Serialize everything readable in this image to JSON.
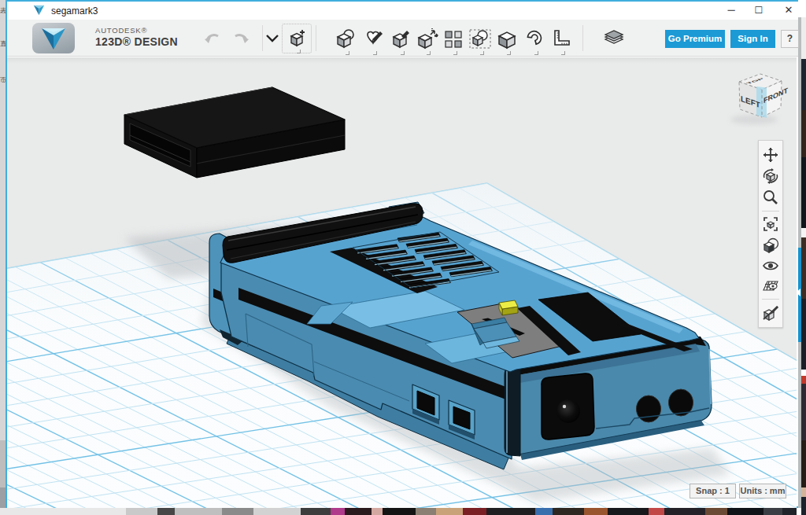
{
  "window": {
    "title": "segamark3",
    "controls": {
      "minimize": "─",
      "maximize": "☐",
      "close": "✕"
    },
    "border_color": "#41aede"
  },
  "background": {
    "left_glyphs": [
      "表",
      "真",
      "页"
    ]
  },
  "brand": {
    "company": "AUTODESK®",
    "product": "123D® DESIGN",
    "caret": "⌄"
  },
  "toolbar": {
    "tools": [
      {
        "name": "undo"
      },
      {
        "name": "redo"
      },
      {
        "name": "primitives"
      },
      {
        "name": "transform"
      },
      {
        "name": "sketch"
      },
      {
        "name": "construct"
      },
      {
        "name": "modify"
      },
      {
        "name": "pattern"
      },
      {
        "name": "grouping"
      },
      {
        "name": "combine"
      },
      {
        "name": "snap"
      },
      {
        "name": "measure"
      },
      {
        "name": "text"
      }
    ],
    "go_premium_label": "Go Premium",
    "sign_in_label": "Sign In",
    "help_label": "?",
    "accent_color": "#1b9ad5"
  },
  "viewcube": {
    "top": "TOP",
    "front": "FRONT",
    "left": "LEFT",
    "highlight_color": "#a9d9ec"
  },
  "navbar": {
    "items": [
      {
        "name": "pan"
      },
      {
        "name": "orbit"
      },
      {
        "name": "zoom"
      },
      {
        "name": "fit"
      },
      {
        "name": "material"
      },
      {
        "name": "visibility"
      },
      {
        "name": "grid"
      },
      {
        "name": "hide-sketches"
      }
    ]
  },
  "status": {
    "snap": "Snap : 1",
    "units": "Units : mm"
  },
  "scene": {
    "objects": [
      {
        "name": "console",
        "color": "#57a3d0",
        "description": "blue game console model"
      },
      {
        "name": "cartridge",
        "color": "#141414",
        "description": "black flat cartridge box floating above grid"
      }
    ],
    "grid": {
      "minor_color": "#bfe2f2",
      "major_color": "#6fc0e6",
      "plane_color": "#fbfdfe",
      "background": "#e9eaea"
    }
  }
}
